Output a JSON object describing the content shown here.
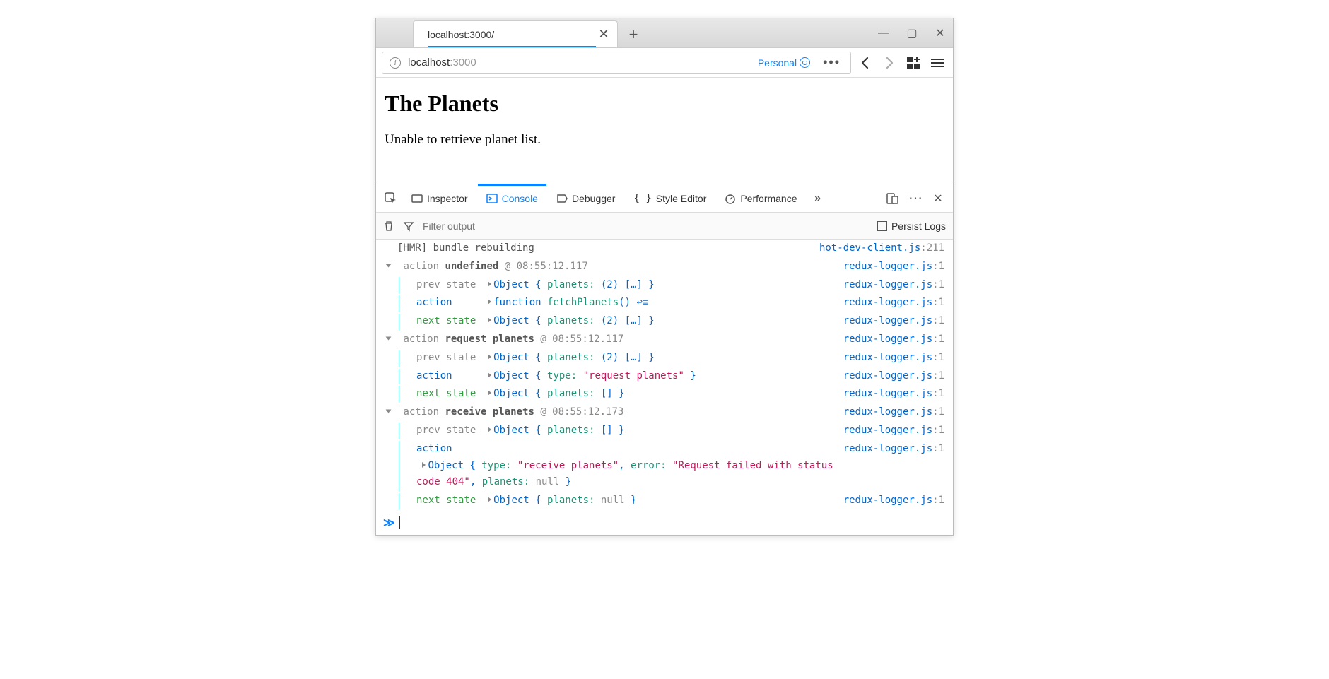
{
  "titlebar": {
    "tab_title": "localhost:3000/",
    "close_glyph": "✕",
    "newtab_glyph": "+",
    "min_glyph": "—",
    "max_glyph": "▢",
    "closewin_glyph": "✕"
  },
  "urlbar": {
    "host": "localhost",
    "port": ":3000",
    "personal_label": "Personal",
    "more_glyph": "•••"
  },
  "page": {
    "heading": "The Planets",
    "message": "Unable to retrieve planet list."
  },
  "devtools": {
    "tabs": {
      "inspector": "Inspector",
      "console": "Console",
      "debugger": "Debugger",
      "style_editor": "Style Editor",
      "performance": "Performance"
    },
    "overflow_glyph": "»",
    "more_glyph": "⋯",
    "close_glyph": "✕",
    "filter_placeholder": "Filter output",
    "persist_label": "Persist Logs"
  },
  "sources": {
    "hot": {
      "file": "hot-dev-client.js",
      "loc": ":211"
    },
    "redux": {
      "file": "redux-logger.js",
      "loc": ":1"
    }
  },
  "log": {
    "hmr": "[HMR] bundle rebuilding",
    "group1": {
      "header_pre": " action ",
      "header_name": "undefined",
      "header_post": " @ 08:55:12.117",
      "prev_label": "prev state",
      "prev_obj_a": "Object { ",
      "prev_obj_b": "planets: ",
      "prev_obj_c": "(2) […] }",
      "action_label": "action",
      "action_val_a": "function ",
      "action_val_b": "fetchPlanets",
      "action_val_c": "() ↩≡",
      "next_label": "next state",
      "next_obj_a": "Object { ",
      "next_obj_b": "planets: ",
      "next_obj_c": "(2) […] }"
    },
    "group2": {
      "header_pre": " action ",
      "header_name": "request planets",
      "header_post": " @ 08:55:12.117",
      "prev_label": "prev state",
      "prev_obj_a": "Object { ",
      "prev_obj_b": "planets: ",
      "prev_obj_c": "(2) […] }",
      "action_label": "action",
      "act_obj_a": "Object { ",
      "act_obj_b": "type: ",
      "act_obj_c": "\"request planets\"",
      "act_obj_d": " }",
      "next_label": "next state",
      "next_obj_a": "Object { ",
      "next_obj_b": "planets: ",
      "next_obj_c": "[] }"
    },
    "group3": {
      "header_pre": " action ",
      "header_name": "receive planets",
      "header_post": " @ 08:55:12.173",
      "prev_label": "prev state",
      "prev_obj_a": "Object { ",
      "prev_obj_b": "planets: ",
      "prev_obj_c": "[] }",
      "action_label": "action",
      "act_obj_a": "Object { ",
      "act_obj_b": "type: ",
      "act_obj_c": "\"receive planets\"",
      "act_obj_d": ", ",
      "act_obj_e": "error: ",
      "act_obj_f": "\"Request failed with status code 404\"",
      "act_obj_g": ", ",
      "act_obj_h": "planets: ",
      "act_obj_i": "null",
      "act_obj_j": " }",
      "next_label": "next state",
      "next_obj_a": "Object { ",
      "next_obj_b": "planets: ",
      "next_obj_c": "null",
      "next_obj_d": " }"
    }
  },
  "prompt_glyph": "≫"
}
